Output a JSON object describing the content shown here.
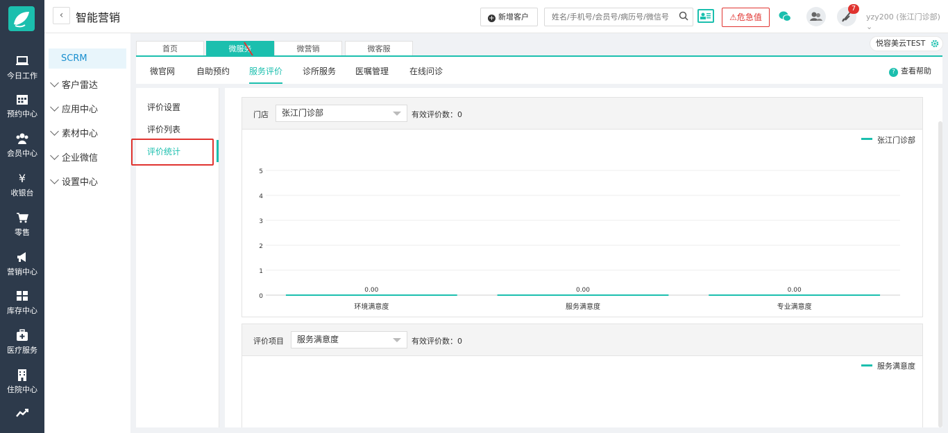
{
  "nav": {
    "items": [
      {
        "label": "今日工作",
        "icon": "laptop-icon"
      },
      {
        "label": "预约中心",
        "icon": "calendar-icon"
      },
      {
        "label": "会员中心",
        "icon": "users-icon"
      },
      {
        "label": "收银台",
        "icon": "yen-icon"
      },
      {
        "label": "零售",
        "icon": "cart-icon"
      },
      {
        "label": "营销中心",
        "icon": "megaphone-icon"
      },
      {
        "label": "库存中心",
        "icon": "grid-icon"
      },
      {
        "label": "医疗服务",
        "icon": "medkit-icon"
      },
      {
        "label": "住院中心",
        "icon": "building-icon"
      },
      {
        "label": "",
        "icon": "trend-icon"
      }
    ]
  },
  "header": {
    "back": "‹",
    "title": "智能营销",
    "add_customer": "新增客户",
    "search_placeholder": "姓名/手机号/会员号/病历号/微信号",
    "danger_label": "危急值",
    "badge_count": "7",
    "user": "yzy200 (张江门诊部)"
  },
  "modules": {
    "active": "SCRM",
    "items": [
      "客户雷达",
      "应用中心",
      "素材中心",
      "企业微信",
      "设置中心"
    ]
  },
  "tabs": [
    {
      "label": "首页",
      "active": false
    },
    {
      "label": "微服务",
      "active": true
    },
    {
      "label": "微营销",
      "active": false
    },
    {
      "label": "微客服",
      "active": false
    }
  ],
  "tenant": "悦容美云TEST",
  "subnav": {
    "items": [
      "微官网",
      "自助预约",
      "服务评价",
      "诊所服务",
      "医嘱管理",
      "在线问诊"
    ],
    "active_index": 2,
    "help": "查看帮助"
  },
  "leftpanel": {
    "items": [
      "评价设置",
      "评价列表",
      "评价统计"
    ],
    "active_index": 2
  },
  "panel1": {
    "store_label": "门店",
    "store_value": "张江门诊部",
    "count_label": "有效评价数：0"
  },
  "panel2": {
    "item_label": "评价项目",
    "item_value": "服务满意度",
    "count_label": "有效评价数：0",
    "legend": "服务满意度"
  },
  "chart_data": {
    "type": "bar",
    "categories": [
      "环境满意度",
      "服务满意度",
      "专业满意度"
    ],
    "series": [
      {
        "name": "张江门诊部",
        "values": [
          0,
          0,
          0
        ]
      }
    ],
    "data_labels": [
      "0.00",
      "0.00",
      "0.00"
    ],
    "ylim": [
      0,
      5
    ],
    "yticks": [
      0,
      1,
      2,
      3,
      4,
      5
    ],
    "grid": true,
    "legend": "top-right",
    "color": "#1bbfae"
  }
}
